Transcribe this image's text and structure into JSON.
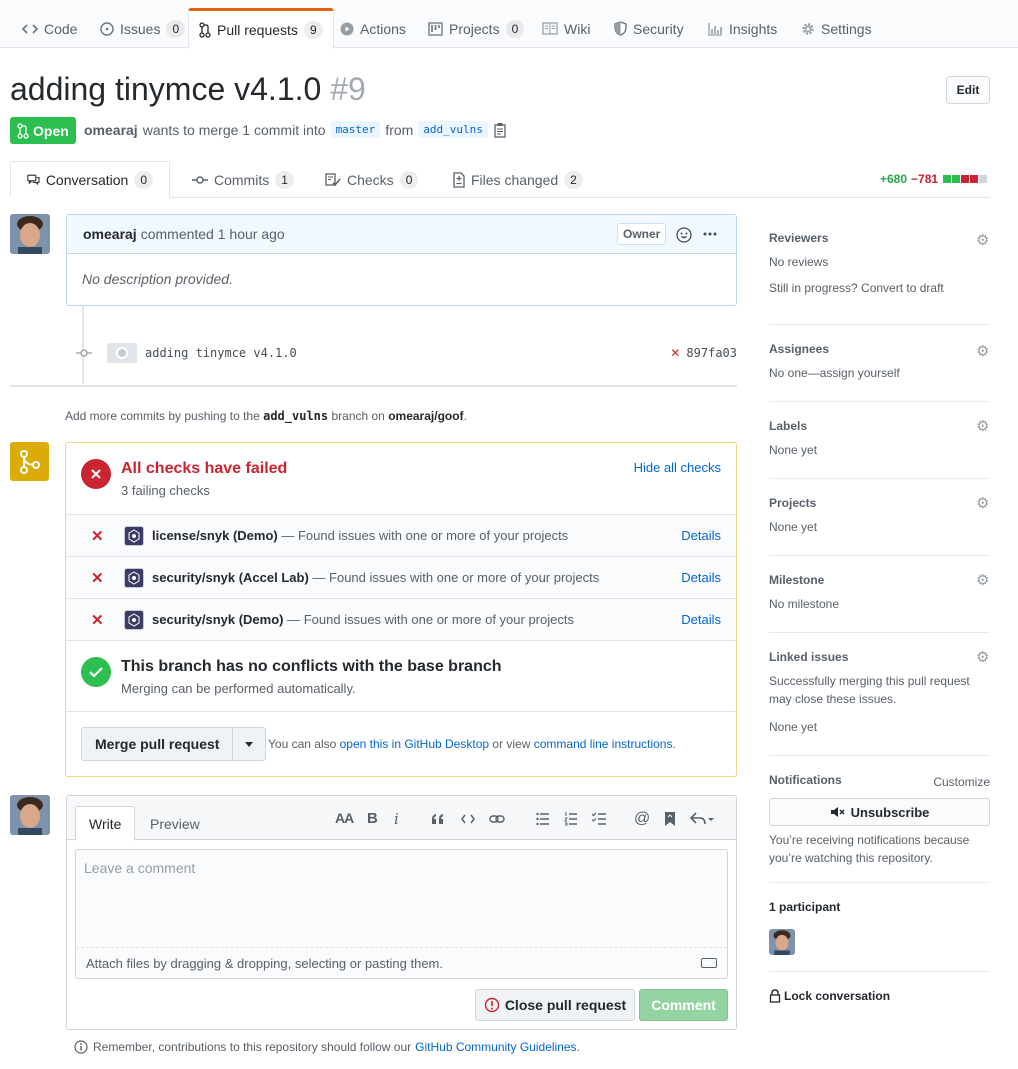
{
  "repo_nav": {
    "tabs": [
      {
        "label": "Code",
        "icon": "code-icon"
      },
      {
        "label": "Issues",
        "count": "0",
        "icon": "issue-icon"
      },
      {
        "label": "Pull requests",
        "count": "9",
        "icon": "pull-request-icon",
        "active": true
      },
      {
        "label": "Actions",
        "icon": "play-icon"
      },
      {
        "label": "Projects",
        "count": "0",
        "icon": "project-icon"
      },
      {
        "label": "Wiki",
        "icon": "book-icon"
      },
      {
        "label": "Security",
        "icon": "shield-icon"
      },
      {
        "label": "Insights",
        "icon": "graph-icon"
      },
      {
        "label": "Settings",
        "icon": "gear-icon"
      }
    ]
  },
  "pr": {
    "title": "adding tinymce v4.1.0",
    "number": "#9",
    "edit_label": "Edit",
    "state": "Open",
    "author": "omearaj",
    "meta_middle": "wants to merge 1 commit into",
    "base_branch": "master",
    "from_word": "from",
    "head_branch": "add_vulns"
  },
  "pr_tabs": [
    {
      "label": "Conversation",
      "count": "0",
      "icon": "comment-discussion-icon"
    },
    {
      "label": "Commits",
      "count": "1",
      "icon": "commit-icon"
    },
    {
      "label": "Checks",
      "count": "0",
      "icon": "checklist-icon"
    },
    {
      "label": "Files changed",
      "count": "2",
      "icon": "file-diff-icon"
    }
  ],
  "diffstat": {
    "added": "+680",
    "removed": "−781"
  },
  "comment": {
    "author": "omearaj",
    "action": "commented 1 hour ago",
    "badge": "Owner",
    "body": "No description provided."
  },
  "commit": {
    "message": "adding tinymce v4.1.0",
    "sha": "897fa03"
  },
  "push_note": {
    "prefix": "Add more commits by pushing to the",
    "branch": "add_vulns",
    "middle": "branch on",
    "repo": "omearaj/goof",
    "suffix": "."
  },
  "merge_box": {
    "checks_title": "All checks have failed",
    "checks_sub": "3 failing checks",
    "hide_label": "Hide all checks",
    "checks": [
      {
        "name": "license/snyk (Demo)",
        "desc": " — Found issues with one or more of your projects",
        "link": "Details"
      },
      {
        "name": "security/snyk (Accel Lab)",
        "desc": " — Found issues with one or more of your projects",
        "link": "Details"
      },
      {
        "name": "security/snyk (Demo)",
        "desc": " — Found issues with one or more of your projects",
        "link": "Details"
      }
    ],
    "conflict_title": "This branch has no conflicts with the base branch",
    "conflict_sub": "Merging can be performed automatically.",
    "merge_label": "Merge pull request",
    "also_prefix": "You can also",
    "desktop_link": "open this in GitHub Desktop",
    "or_view": "or view",
    "cli_link": "command line instructions",
    "period": "."
  },
  "new_comment": {
    "write_tab": "Write",
    "preview_tab": "Preview",
    "placeholder": "Leave a comment",
    "attach_text": "Attach files by dragging & dropping, selecting or pasting them.",
    "close_label": "Close pull request",
    "comment_label": "Comment",
    "toolbar": {
      "header": "AA",
      "bold": "B",
      "italic": "i"
    }
  },
  "guidelines": {
    "prefix": "Remember, contributions to this repository should follow our",
    "link": "GitHub Community Guidelines",
    "suffix": "."
  },
  "sidebar": {
    "reviewers": {
      "title": "Reviewers",
      "line1": "No reviews",
      "line2": "Still in progress? Convert to draft"
    },
    "assignees": {
      "title": "Assignees",
      "line1": "No one—assign yourself"
    },
    "labels": {
      "title": "Labels",
      "line1": "None yet"
    },
    "projects": {
      "title": "Projects",
      "line1": "None yet"
    },
    "milestone": {
      "title": "Milestone",
      "line1": "No milestone"
    },
    "linked": {
      "title": "Linked issues",
      "line1": "Successfully merging this pull request",
      "line1b": "may close these issues.",
      "line2": "None yet"
    },
    "notifications": {
      "title": "Notifications",
      "customize": "Customize",
      "unsubscribe": "Unsubscribe",
      "line1": "You’re receiving notifications because",
      "line1b": "you’re watching this repository."
    },
    "participants": {
      "title": "1 participant"
    },
    "lock": "Lock conversation"
  },
  "colors": {
    "open_green": "#2cbe4e",
    "fail_red": "#cb2431",
    "link_blue": "#0366d6",
    "merge_yellow": "#dbab09"
  }
}
